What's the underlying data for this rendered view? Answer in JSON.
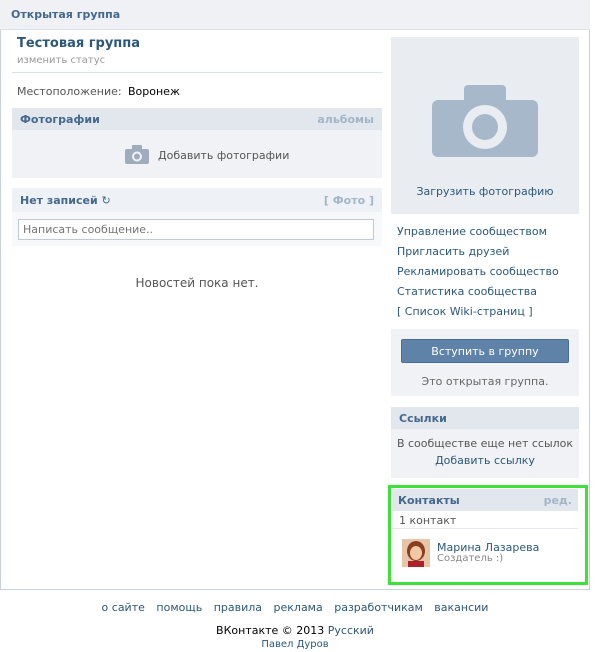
{
  "header": {
    "title": "Открытая группа"
  },
  "group": {
    "name": "Тестовая группа",
    "status_link": "изменить статус",
    "location_label": "Местоположение:",
    "location_value": "Воронеж"
  },
  "photos": {
    "title": "Фотографии",
    "albums_link": "альбомы",
    "add_label": "Добавить фотографии"
  },
  "wall": {
    "title": "Нет записей",
    "photo_link": "[ Фото ]",
    "placeholder": "Написать сообщение..",
    "empty_text": "Новостей пока нет."
  },
  "sidebar": {
    "upload_photo": "Загрузить фотографию",
    "menu": [
      "Управление сообществом",
      "Пригласить друзей",
      "Рекламировать сообщество",
      "Статистика сообщества",
      "[ Список Wiki-страниц ]"
    ],
    "join_button": "Вступить в группу",
    "open_group_note": "Это открытая группа.",
    "links": {
      "title": "Ссылки",
      "empty_text": "В сообществе еще нет ссылок",
      "add_link": "Добавить ссылку"
    },
    "contacts": {
      "title": "Контакты",
      "edit_link": "ред.",
      "count": "1 контакт",
      "name": "Марина Лазарева",
      "role": "Создатель :)"
    }
  },
  "footer": {
    "links": [
      "о сайте",
      "помощь",
      "правила",
      "реклама",
      "разработчикам",
      "вакансии"
    ],
    "copyright": "ВКонтакте © 2013",
    "language": "Русский",
    "author": "Павел Дуров"
  },
  "colors": {
    "highlight": "#3ee03a",
    "link": "#2b587a",
    "header_text": "#45688e"
  }
}
